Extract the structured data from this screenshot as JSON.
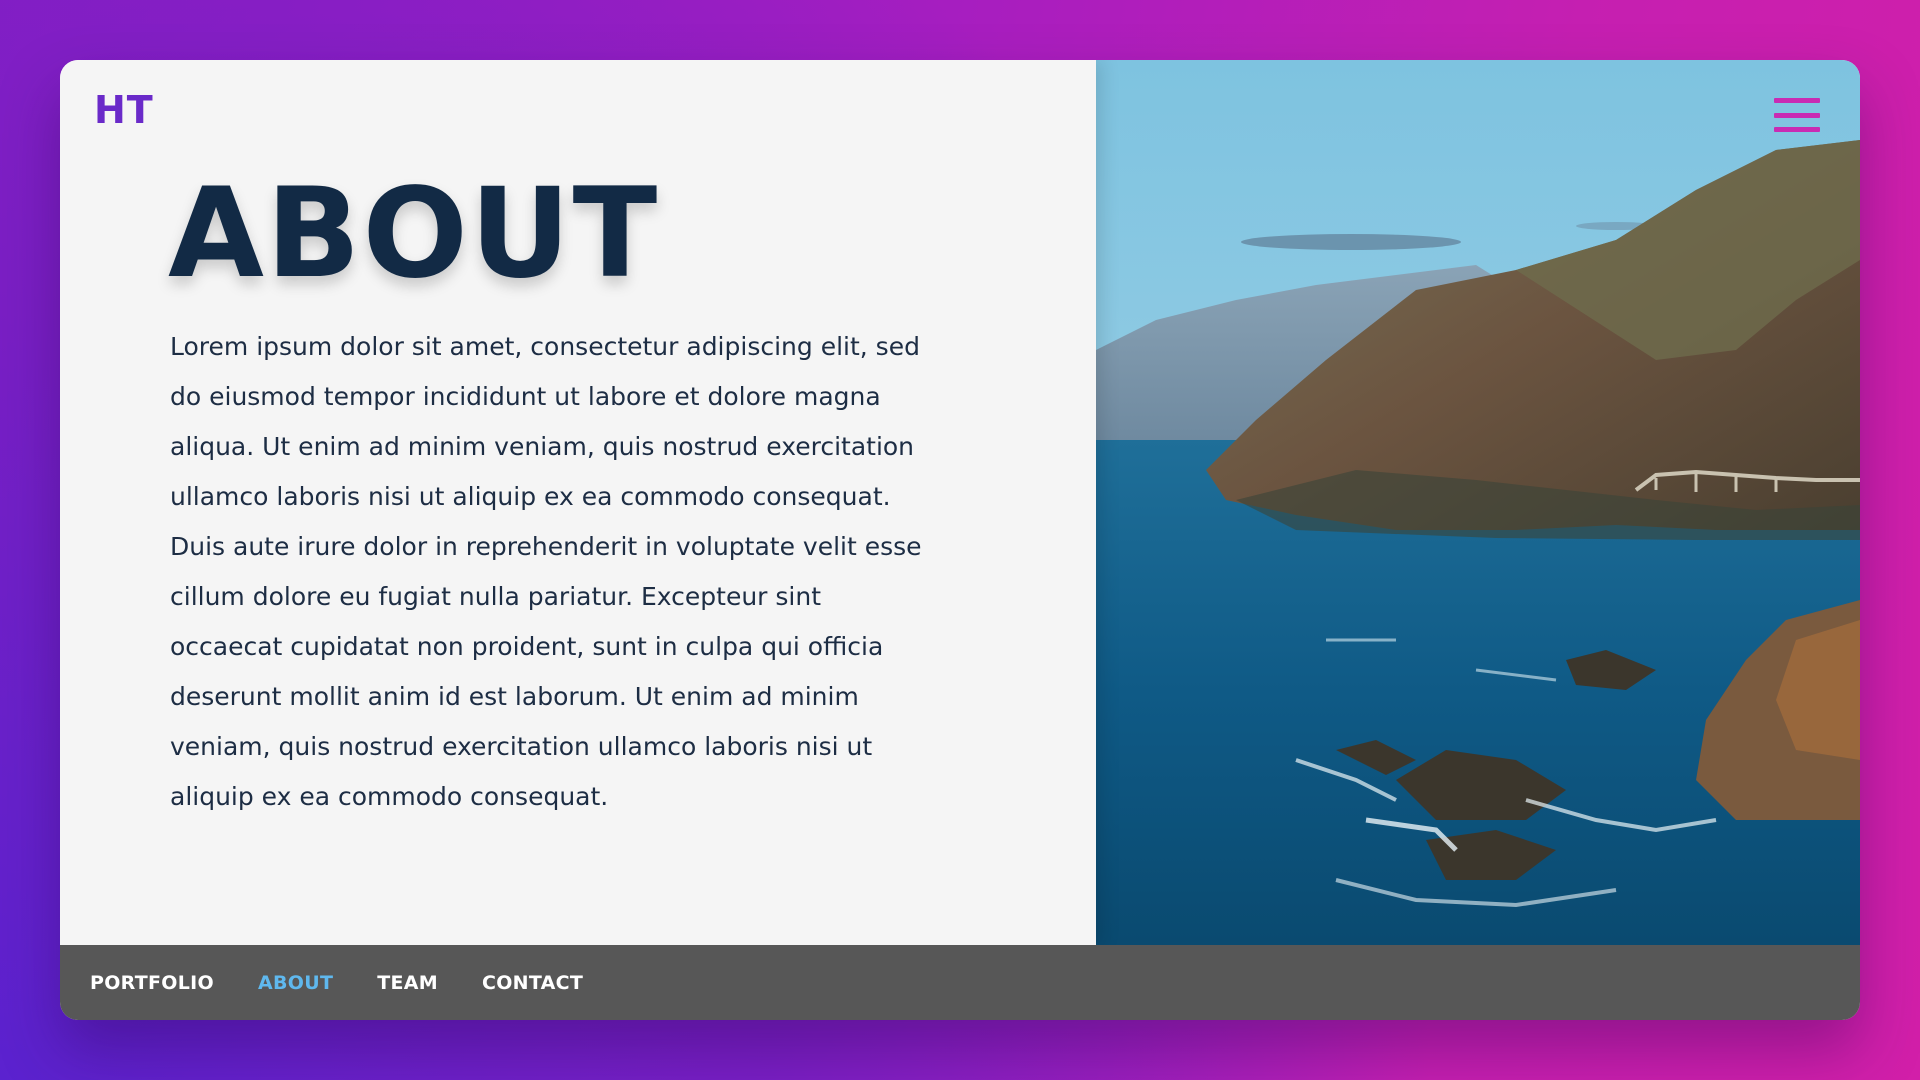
{
  "logo": {
    "text": "HT"
  },
  "page": {
    "title": "ABOUT",
    "body": "Lorem ipsum dolor sit amet, consectetur adipiscing elit, sed do eiusmod tempor incididunt ut labore et dolore magna aliqua. Ut enim ad minim veniam, quis nostrud exercitation ullamco laboris nisi ut aliquip ex ea commodo consequat. Duis aute irure dolor in reprehenderit in voluptate velit esse cillum dolore eu fugiat nulla pariatur. Excepteur sint occaecat cupidatat non proident, sunt in culpa qui officia deserunt mollit anim id est laborum. Ut enim ad minim veniam, quis nostrud exercitation ullamco laboris nisi ut aliquip ex ea commodo consequat."
  },
  "menu": {
    "icon": "hamburger-menu-icon"
  },
  "hero_image": {
    "subject": "coastal-cliffs-photo"
  },
  "nav": {
    "items": [
      {
        "label": "PORTFOLIO",
        "active": false
      },
      {
        "label": "ABOUT",
        "active": true
      },
      {
        "label": "TEAM",
        "active": false
      },
      {
        "label": "CONTACT",
        "active": false
      }
    ]
  },
  "colors": {
    "accent": "#6a2ac9",
    "menu_icon": "#c92bb3",
    "heading": "#122a45",
    "nav_active": "#5fb8ee",
    "nav_bg": "#575757",
    "card_bg": "#f5f5f5"
  }
}
